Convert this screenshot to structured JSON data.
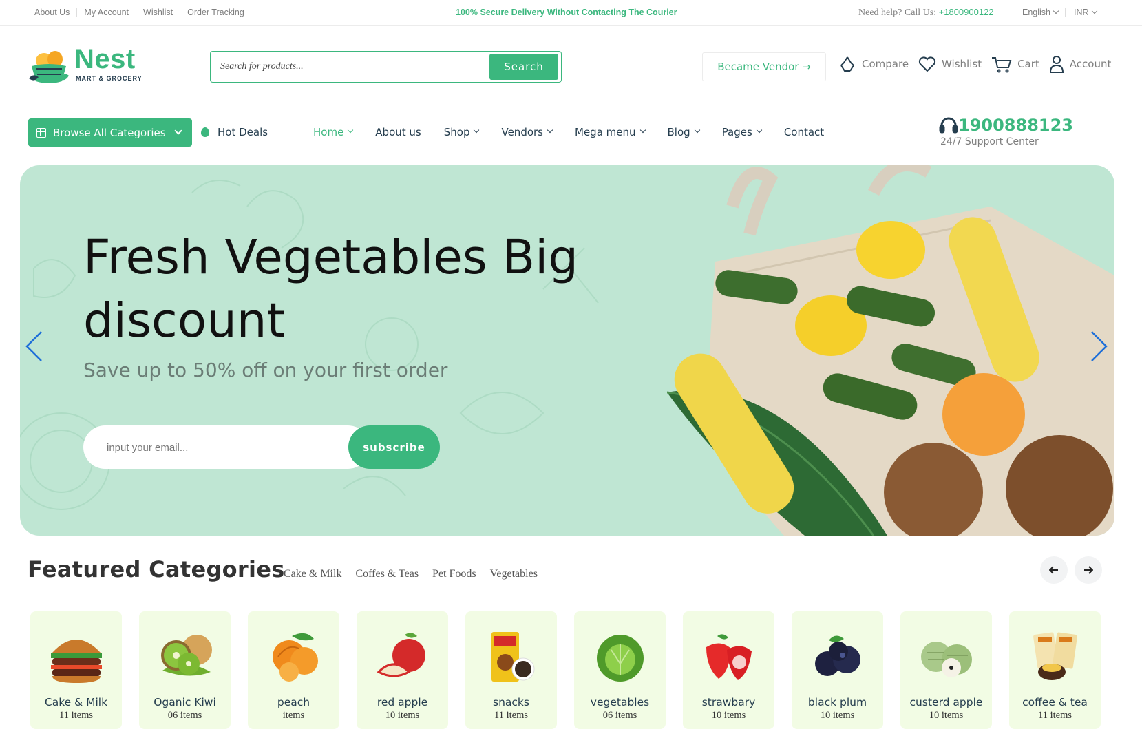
{
  "topbar": {
    "links": [
      "About Us",
      "My Account",
      "Wishlist",
      "Order Tracking"
    ],
    "promo": "100% Secure Delivery Without Contacting The Courier",
    "help_label": "Need help? Call Us:",
    "help_phone": "+1800900122",
    "language": "English",
    "currency": "INR"
  },
  "header": {
    "logo_word": "Nest",
    "logo_sub": "MART & GROCERY",
    "search_placeholder": "Search for products...",
    "search_button": "Search",
    "vendor_button": "Became Vendor →",
    "icons": [
      {
        "label": "Compare",
        "icon": "compare-icon"
      },
      {
        "label": "Wishlist",
        "icon": "heart-icon"
      },
      {
        "label": "Cart",
        "icon": "cart-icon"
      },
      {
        "label": "Account",
        "icon": "user-icon"
      }
    ]
  },
  "nav": {
    "browse": "Browse All Categories",
    "hot_deals": "Hot Deals",
    "menu": [
      {
        "label": "Home",
        "dropdown": true,
        "active": true
      },
      {
        "label": "About us",
        "dropdown": false
      },
      {
        "label": "Shop",
        "dropdown": true
      },
      {
        "label": "Vendors",
        "dropdown": true
      },
      {
        "label": "Mega menu",
        "dropdown": true
      },
      {
        "label": "Blog",
        "dropdown": true
      },
      {
        "label": "Pages",
        "dropdown": true
      },
      {
        "label": "Contact",
        "dropdown": false
      }
    ],
    "support_phone": "1900888123",
    "support_label": "24/7 Support Center"
  },
  "hero": {
    "title": "Fresh Vegetables Big discount",
    "subtitle": "Save up to 50% off on your first order",
    "email_placeholder": "input your email...",
    "subscribe": "subscribe"
  },
  "featured": {
    "title": "Featured Categories",
    "tabs": [
      "Cake & Milk",
      "Coffes & Teas",
      "Pet Foods",
      "Vegetables"
    ],
    "cards": [
      {
        "name": "Cake & Milk",
        "count": "11 items",
        "icon": "burger-icon"
      },
      {
        "name": "Oganic Kiwi",
        "count": "06 items",
        "icon": "kiwi-icon"
      },
      {
        "name": "peach",
        "count": "items",
        "icon": "peach-icon"
      },
      {
        "name": "red apple",
        "count": "10 items",
        "icon": "apple-icon"
      },
      {
        "name": "snacks",
        "count": "11 items",
        "icon": "snacks-icon"
      },
      {
        "name": "vegetables",
        "count": "06 items",
        "icon": "cabbage-icon"
      },
      {
        "name": "strawbary",
        "count": "10 items",
        "icon": "strawberry-icon"
      },
      {
        "name": "black plum",
        "count": "10 items",
        "icon": "plum-icon"
      },
      {
        "name": "custerd apple",
        "count": "10 items",
        "icon": "custard-apple-icon"
      },
      {
        "name": "coffee & tea",
        "count": "11 items",
        "icon": "coffee-icon"
      }
    ]
  },
  "colors": {
    "brand": "#3bb77e",
    "hero_bg": "#bfe6d3",
    "card_bg": "#f2fce4",
    "arrow": "#1e6fd9"
  }
}
